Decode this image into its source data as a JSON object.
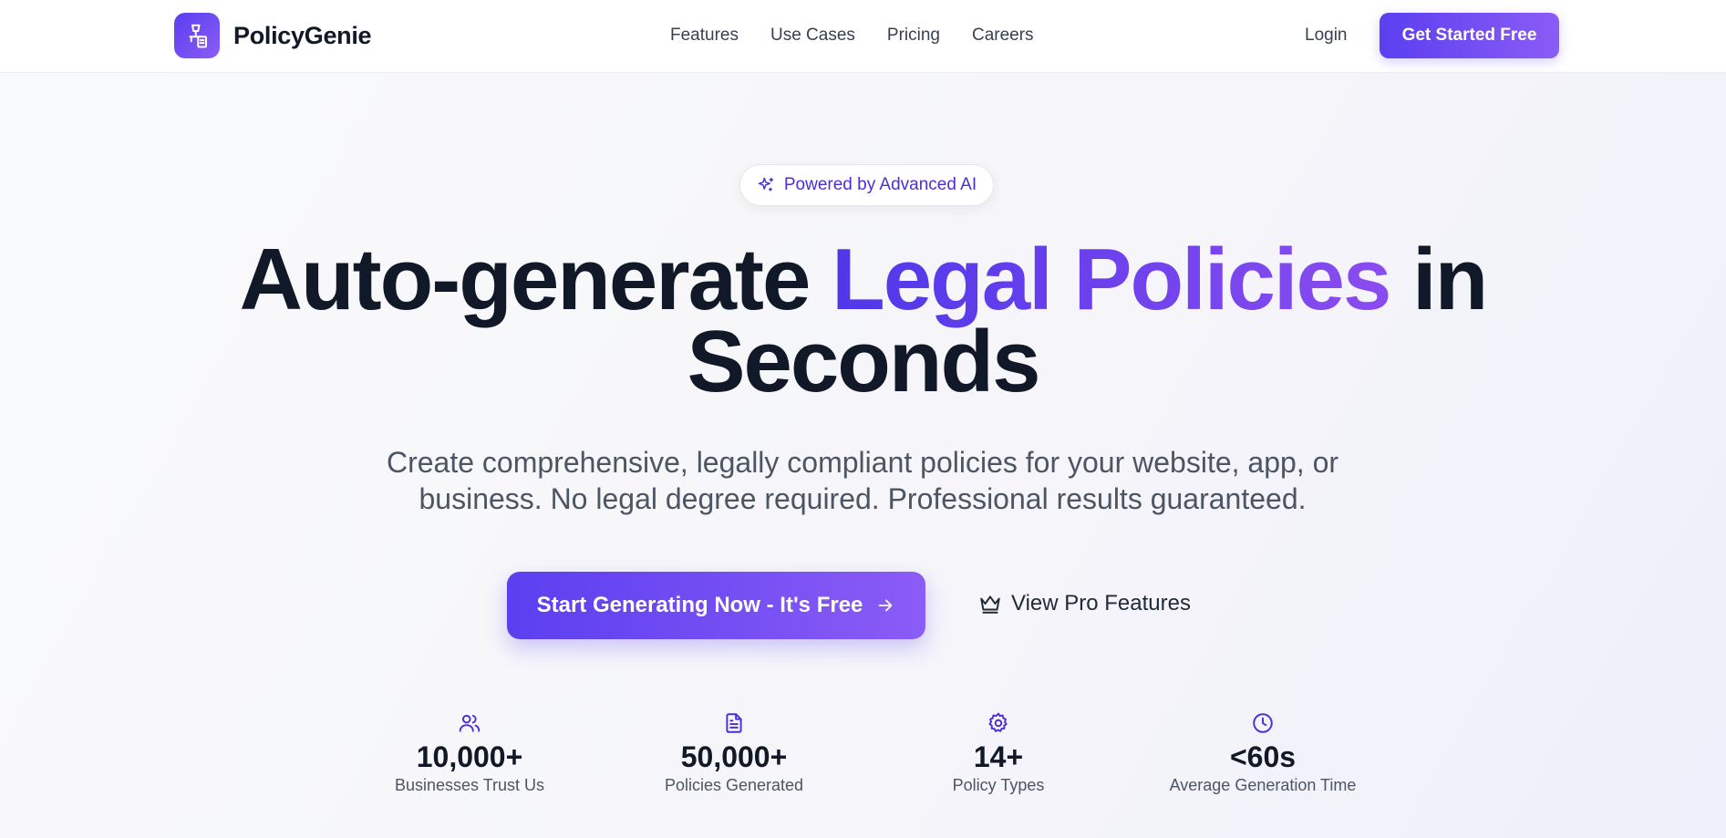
{
  "header": {
    "brand_name": "PolicyGenie",
    "nav": [
      "Features",
      "Use Cases",
      "Pricing",
      "Careers"
    ],
    "login_label": "Login",
    "cta_label": "Get Started Free"
  },
  "hero": {
    "badge_text": "Powered by Advanced AI",
    "headline_part1": "Auto-generate ",
    "headline_accent": "Legal Policies",
    "headline_part2": " in",
    "headline_line2": "Seconds",
    "subtitle_line1": "Create comprehensive, legally compliant policies for your website, app, or",
    "subtitle_line2": "business. No legal degree required. Professional results guaranteed.",
    "primary_cta": "Start Generating Now - It's Free",
    "secondary_cta": "View Pro Features"
  },
  "stats": [
    {
      "icon": "users-icon",
      "value": "10,000+",
      "label": "Businesses Trust Us"
    },
    {
      "icon": "document-icon",
      "value": "50,000+",
      "label": "Policies Generated"
    },
    {
      "icon": "gear-icon",
      "value": "14+",
      "label": "Policy Types"
    },
    {
      "icon": "clock-icon",
      "value": "<60s",
      "label": "Average Generation Time"
    }
  ],
  "colors": {
    "accent_start": "#5b3ff0",
    "accent_end": "#8b5cf6",
    "heading": "#111827",
    "body_text": "#4b5563"
  }
}
